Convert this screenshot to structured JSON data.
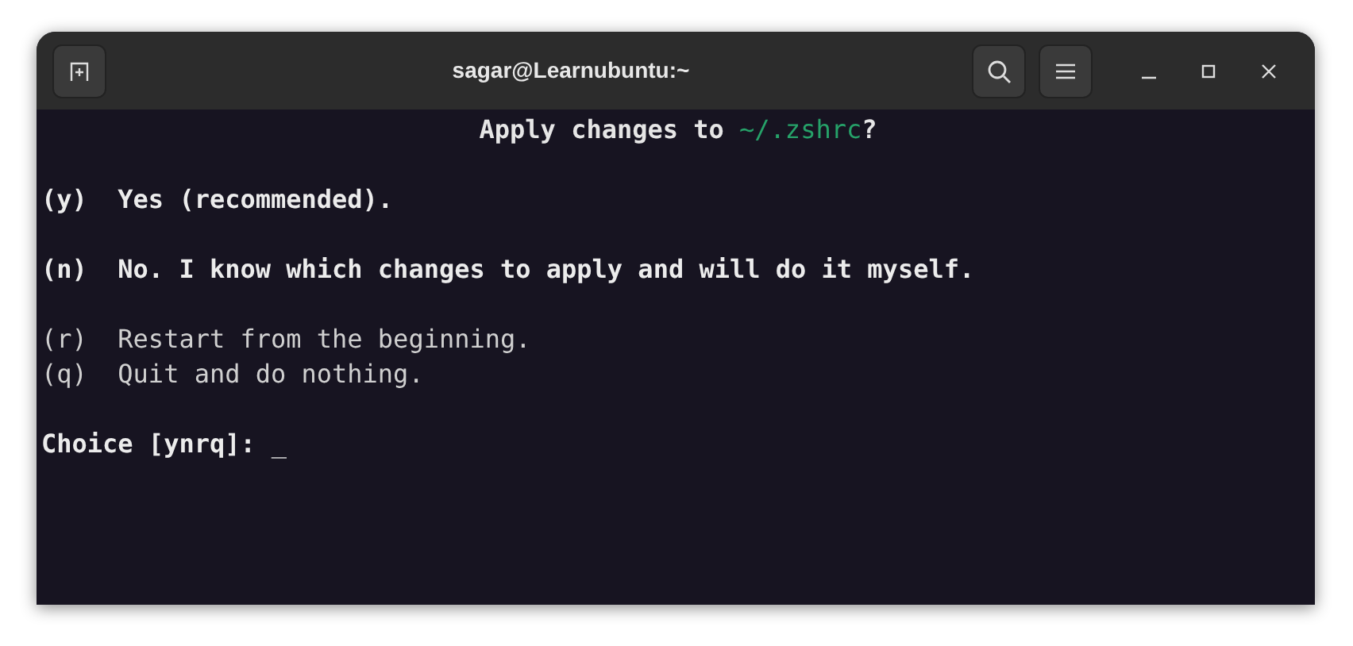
{
  "window": {
    "title": "sagar@Learnubuntu:~"
  },
  "terminal": {
    "lines": [
      {
        "kind": "heading",
        "segments": [
          {
            "text": "Apply changes to ",
            "bold": true
          },
          {
            "text": "~/.zshrc",
            "bold": false,
            "color": "#26a269"
          },
          {
            "text": "?",
            "bold": true
          }
        ]
      },
      {
        "kind": "blank"
      },
      {
        "kind": "option",
        "key": "(y)",
        "text": "Yes (recommended).",
        "bold": true
      },
      {
        "kind": "blank"
      },
      {
        "kind": "option",
        "key": "(n)",
        "text": "No. I know which changes to apply and will do it myself.",
        "bold": true
      },
      {
        "kind": "blank"
      },
      {
        "kind": "option",
        "key": "(r)",
        "text": "Restart from the beginning.",
        "bold": false
      },
      {
        "kind": "option",
        "key": "(q)",
        "text": "Quit and do nothing.",
        "bold": false
      },
      {
        "kind": "blank"
      },
      {
        "kind": "prompt",
        "text": "Choice [ynrq]:",
        "cursor": "_"
      }
    ]
  }
}
